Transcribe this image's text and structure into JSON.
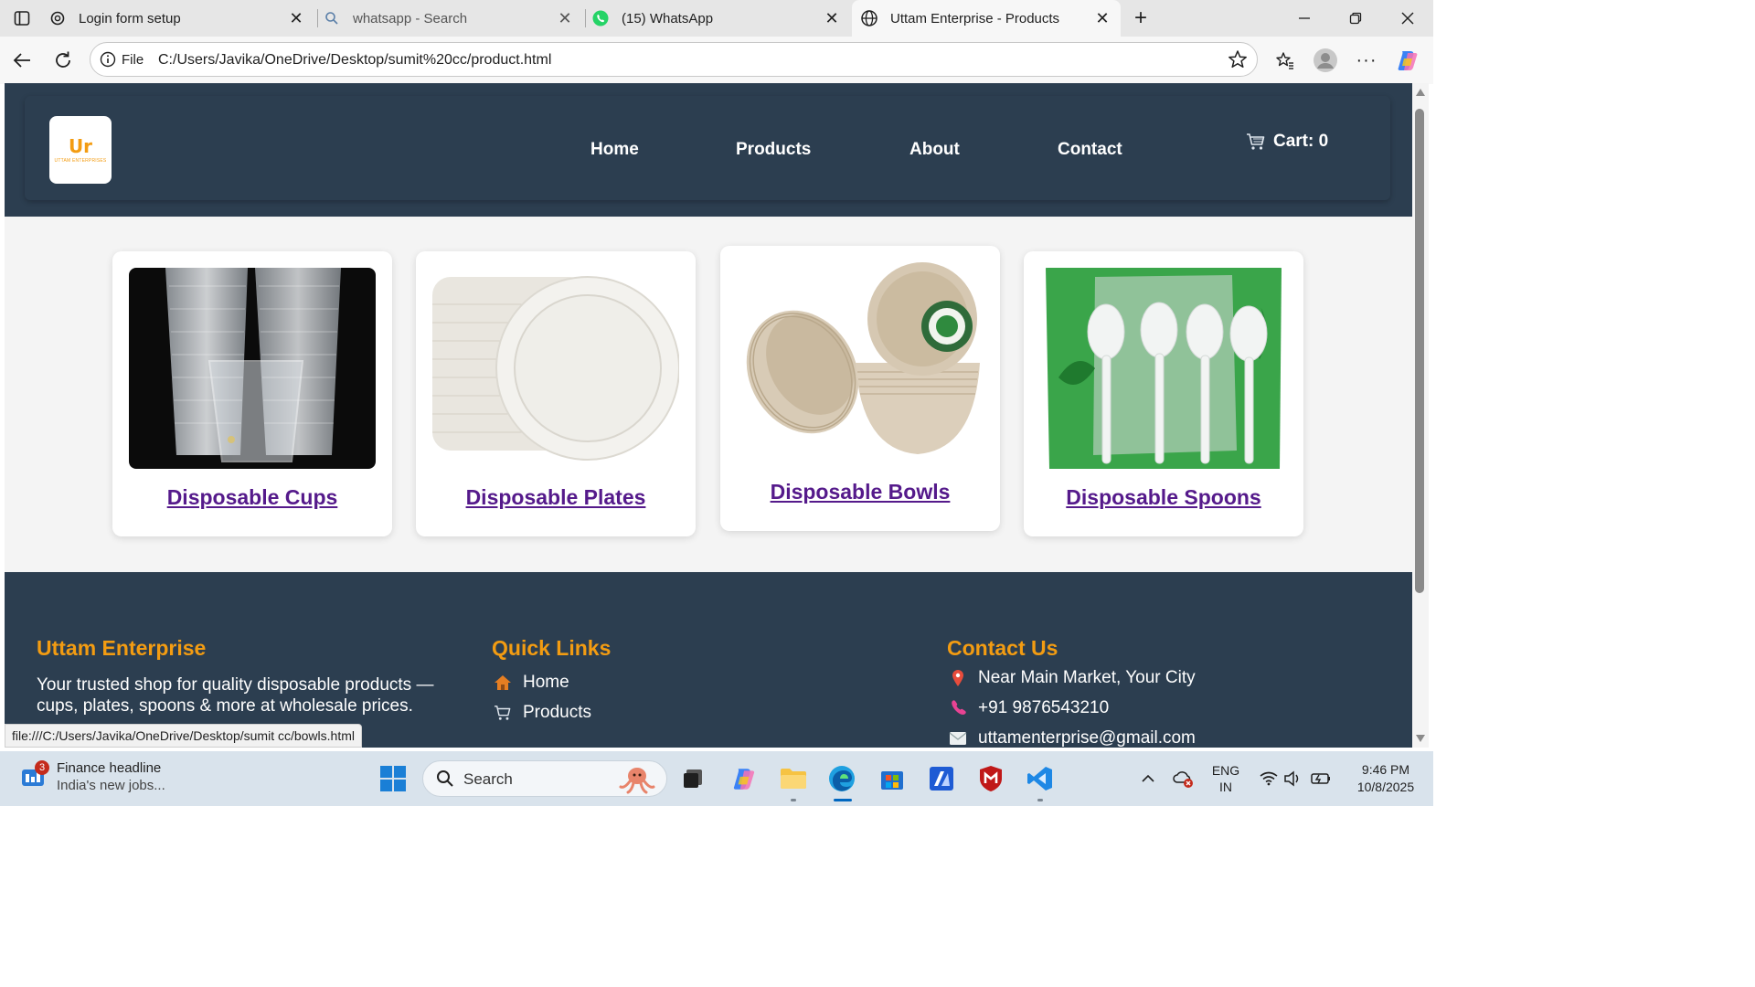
{
  "browser": {
    "tabs": [
      {
        "title": "Login form setup",
        "icon": "chatgpt-icon"
      },
      {
        "title": "whatsapp - Search",
        "icon": "search-icon"
      },
      {
        "title": "(15) WhatsApp",
        "icon": "whatsapp-icon"
      },
      {
        "title": "Uttam Enterprise - Products",
        "icon": "globe-icon"
      }
    ],
    "address": {
      "scheme_label": "File",
      "url": "C:/Users/Javika/OneDrive/Desktop/sumit%20cc/product.html"
    },
    "status_url": "file:///C:/Users/Javika/OneDrive/Desktop/sumit cc/bowls.html"
  },
  "site": {
    "logo": {
      "mark": "Ur",
      "text": "UTTAM ENTERPRISES"
    },
    "nav": [
      "Home",
      "Products",
      "About",
      "Contact"
    ],
    "cart_label": "Cart: 0",
    "products": [
      {
        "name": "Disposable Cups",
        "image": "disposable-cups-photo"
      },
      {
        "name": "Disposable Plates",
        "image": "disposable-plates-photo"
      },
      {
        "name": "Disposable Bowls",
        "image": "disposable-bowls-photo"
      },
      {
        "name": "Disposable Spoons",
        "image": "disposable-spoons-photo"
      }
    ],
    "footer": {
      "about_heading": "Uttam Enterprise",
      "about_text_line1": "Your trusted shop for quality disposable products —",
      "about_text_line2": "cups, plates, spoons & more at wholesale prices.",
      "links_heading": "Quick Links",
      "links": [
        "Home",
        "Products"
      ],
      "contact_heading": "Contact Us",
      "address": "Near Main Market, Your City",
      "phone": "+91 9876543210",
      "email": "uttamenterprise@gmail.com"
    },
    "colors": {
      "header_bg": "#2c3e50",
      "accent": "#f39c12",
      "link": "#551a8b"
    }
  },
  "taskbar": {
    "news_title": "Finance headline",
    "news_subtitle": "India's new jobs...",
    "news_badge": "3",
    "search_label": "Search",
    "lang_line1": "ENG",
    "lang_line2": "IN",
    "time": "9:46 PM",
    "date": "10/8/2025"
  }
}
